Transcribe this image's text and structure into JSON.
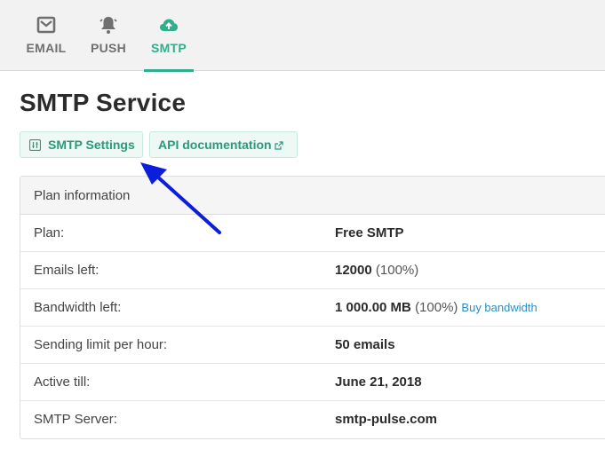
{
  "nav": {
    "tabs": [
      {
        "label": "EMAIL",
        "icon": "envelope-icon"
      },
      {
        "label": "PUSH",
        "icon": "bell-icon"
      },
      {
        "label": "SMTP",
        "icon": "cloud-upload-icon"
      }
    ],
    "active": "SMTP"
  },
  "page": {
    "title": "SMTP Service",
    "buttons": {
      "settings": "SMTP Settings",
      "api": "API documentation"
    }
  },
  "plan": {
    "header": "Plan information",
    "rows": [
      {
        "label": "Plan:",
        "value": "Free SMTP"
      },
      {
        "label": "Emails left:",
        "value": "12000",
        "extra": "(100%)"
      },
      {
        "label": "Bandwidth left:",
        "value": "1 000.00 MB",
        "extra": "(100%)",
        "link": "Buy bandwidth"
      },
      {
        "label": "Sending limit per hour:",
        "value": "50 emails"
      },
      {
        "label": "Active till:",
        "value": "June 21, 2018"
      },
      {
        "label": "SMTP Server:",
        "value": "smtp-pulse.com"
      }
    ]
  },
  "colors": {
    "accent": "#2fae8b",
    "annotation_arrow": "#0a1edb",
    "link": "#2b8fc7"
  }
}
